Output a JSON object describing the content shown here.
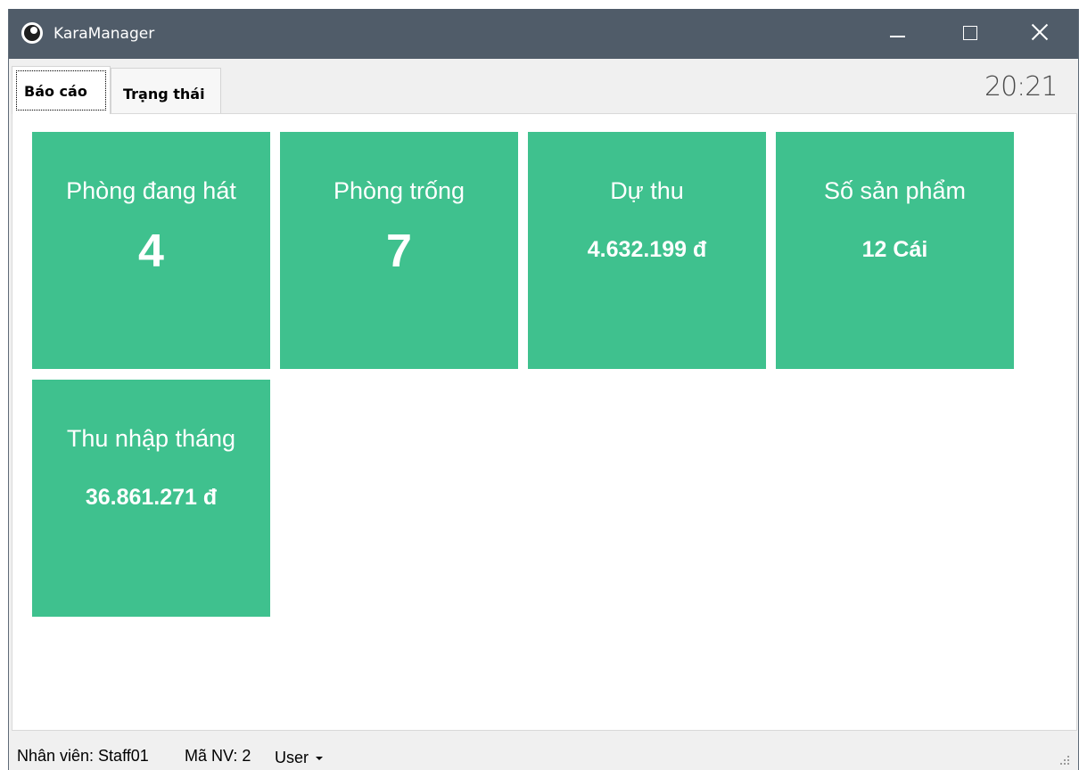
{
  "window": {
    "title": "KaraManager"
  },
  "tabs": [
    {
      "label": "Báo cáo",
      "active": true
    },
    {
      "label": "Trạng thái",
      "active": false
    }
  ],
  "clock": "20:21",
  "cards": [
    {
      "title": "Phòng đang hát",
      "value": "4"
    },
    {
      "title": "Phòng trống",
      "value": "7"
    },
    {
      "title": "Dự thu",
      "value": "4.632.199 đ"
    },
    {
      "title": "Số sản phẩm",
      "value": "12 Cái"
    },
    {
      "title": "Thu nhập tháng",
      "value": "36.861.271 đ"
    }
  ],
  "status": {
    "staff": "Nhân viên: Staff01",
    "staff_id": "Mã NV: 2",
    "role": "User"
  },
  "colors": {
    "card": "#3fc18e",
    "titlebar": "#505c69"
  }
}
